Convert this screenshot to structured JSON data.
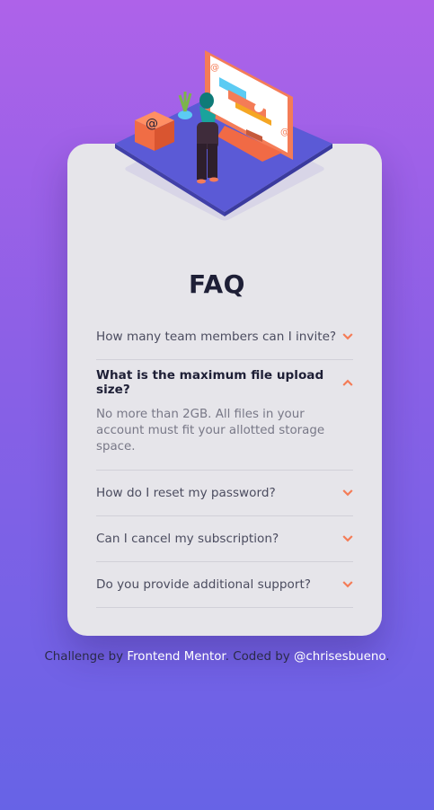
{
  "title": "FAQ",
  "items": [
    {
      "question": "How many team members can I invite?",
      "open": false
    },
    {
      "question": "What is the maximum file upload size?",
      "open": true,
      "answer": "No more than 2GB. All files in your account must fit your allotted storage space."
    },
    {
      "question": "How do I reset my password?",
      "open": false
    },
    {
      "question": "Can I cancel my subscription?",
      "open": false
    },
    {
      "question": "Do you provide additional support?",
      "open": false
    }
  ],
  "attribution": {
    "prefix": "Challenge by",
    "link1": "Frontend Mentor",
    "middle": ". Coded by",
    "link2": "@chrisesbueno",
    "suffix": "."
  },
  "colors": {
    "accent": "#f47c57",
    "heading": "#1e1f36",
    "text": "#4b4c5f",
    "muted": "#787887",
    "card": "#e6e5ea",
    "gradient_top": "#ae62e9",
    "gradient_bottom": "#6763e6"
  }
}
